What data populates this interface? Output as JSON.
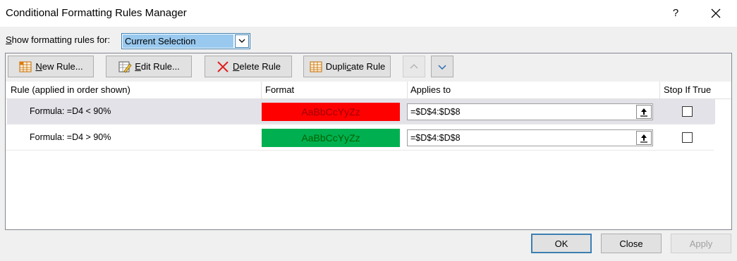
{
  "window": {
    "title": "Conditional Formatting Rules Manager",
    "help_label": "?"
  },
  "scope": {
    "label_prefix": "",
    "label_hotkey": "S",
    "label_rest": "how formatting rules for:",
    "selected": "Current Selection"
  },
  "toolbar": {
    "new_rule": {
      "hotkey": "N",
      "rest": "ew Rule..."
    },
    "edit_rule": {
      "hotkey": "E",
      "rest": "dit Rule..."
    },
    "delete_rule": {
      "hotkey": "D",
      "rest": "elete Rule"
    },
    "duplicate_rule": {
      "before": "Dupli",
      "hotkey": "c",
      "rest": "ate Rule"
    }
  },
  "columns": {
    "rule": "Rule (applied in order shown)",
    "format": "Format",
    "applies_to": "Applies to",
    "stop_if_true": "Stop If True"
  },
  "rules": [
    {
      "rule": "Formula: =D4 < 90%",
      "format_sample": "AaBbCcYyZz",
      "format_bg": "#ff0000",
      "format_fg": "#9c0006",
      "applies_to": "=$D$4:$D$8",
      "stop_if_true": false,
      "selected": true
    },
    {
      "rule": "Formula: =D4 > 90%",
      "format_sample": "AaBbCcYyZz",
      "format_bg": "#00b050",
      "format_fg": "#006100",
      "applies_to": "=$D$4:$D$8",
      "stop_if_true": false,
      "selected": false
    }
  ],
  "buttons": {
    "ok": "OK",
    "close": "Close",
    "apply": "Apply"
  }
}
